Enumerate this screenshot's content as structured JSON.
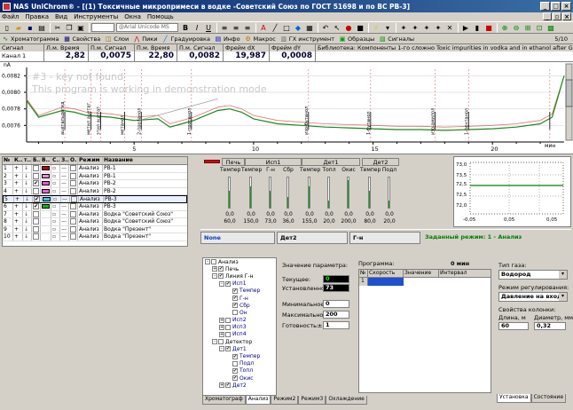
{
  "window": {
    "title": "NAS UniChrom® - [(1) Токсичные микропримеси в водке -Советский Союз по ГОСТ 51698 и по ВС РВ-3]"
  },
  "menu": [
    "Файл",
    "Правка",
    "Вид",
    "Инструменты",
    "Окна",
    "Помощь"
  ],
  "toolbar": {
    "font": "@Arial Unicode MS"
  },
  "tabs": [
    "Хроматограмма",
    "Свойства",
    "Слои",
    "Пики",
    "Градуировка",
    "Инфо",
    "Макрос",
    "ГХ инструмент",
    "Образцы",
    "Сигналы"
  ],
  "page_counter": "5/10",
  "measure": {
    "headers": [
      "Сигнал",
      "Л.м. Время",
      "П.м. Сигнал",
      "П.м. Время",
      "П.м. Сигнал",
      "Фрейм dX",
      "Фрейм dY",
      "Библиотека: Компоненты 1-го сложно Toxic impurities in vodka and in ethanol after GOST 51698 and MC- Template from Vita"
    ],
    "signal": "Канал 1",
    "values": [
      "2,82",
      "0,0075",
      "22,80",
      "0,0082",
      "19,987",
      "0,0008"
    ]
  },
  "chart": {
    "watermark1": "#3 - key not found",
    "watermark2": "This program is working in demonstration mode",
    "unit": "nA",
    "xunit": "мин",
    "yticks": [
      "0,0082",
      "0,0080",
      "0,0078",
      "0,0076"
    ],
    "xticks": [
      "5",
      "10",
      "15",
      "20"
    ],
    "peaks": [
      "ацетальдегид",
      "метил ацетат",
      "этил ацетат",
      "метанол",
      "2-пропанол",
      "1-пропанол",
      "изо-бутанол",
      "1-бутанол",
      "изо-амилол",
      "1-пентанол"
    ]
  },
  "chart_data": {
    "type": "line",
    "xlabel": "мин",
    "ylabel": "nA",
    "xlim": [
      0.5,
      23
    ],
    "ylim": [
      0.0074,
      0.0083
    ],
    "x": [
      0.5,
      1,
      2,
      2.5,
      3,
      3.5,
      4,
      4.5,
      5,
      5.5,
      6,
      6.5,
      7,
      7.5,
      8,
      8.5,
      9,
      9.5,
      10,
      11,
      12,
      13,
      14,
      15,
      16,
      17,
      18,
      19,
      20,
      21,
      22,
      22.5,
      23
    ],
    "series": [
      {
        "values": [
          0.0079,
          0.0077,
          0.00778,
          0.00776,
          0.00772,
          0.00771,
          0.0077,
          0.00768,
          0.00766,
          0.00767,
          0.00768,
          0.00758,
          0.00762,
          0.00766,
          0.00772,
          0.00778,
          0.0078,
          0.00776,
          0.00768,
          0.00762,
          0.0076,
          0.00758,
          0.00757,
          0.00756,
          0.00755,
          0.00755,
          0.00754,
          0.00755,
          0.00756,
          0.00758,
          0.00762,
          0.0077,
          0.0082
        ]
      },
      {
        "values": [
          0.00792,
          0.00772,
          0.00782,
          0.0078,
          0.00776,
          0.00775,
          0.00774,
          0.00772,
          0.0077,
          0.00771,
          0.00772,
          0.00762,
          0.00766,
          0.0077,
          0.00776,
          0.00782,
          0.00784,
          0.0078,
          0.00772,
          0.00766,
          0.00764,
          0.00762,
          0.00761,
          0.0076,
          0.00759,
          0.00759,
          0.00758,
          0.00759,
          0.0076,
          0.00762,
          0.00766,
          0.00774,
          0.0082
        ]
      }
    ]
  },
  "peak_table": {
    "headers": [
      "№",
      "К..",
      "т..",
      "Б..",
      "В..",
      "С..",
      "З..",
      "О..",
      "Режим",
      "Название"
    ],
    "rows": [
      {
        "n": "1",
        "k": "+",
        "b": "",
        "color": "#c00000",
        "mode": "Анализ",
        "name": "РВ-1"
      },
      {
        "n": "2",
        "k": "+",
        "b": "",
        "color": "#ff8ad8",
        "mode": "Анализ",
        "name": "РВ-1"
      },
      {
        "n": "3",
        "k": "+",
        "b": "✔",
        "color": "#ff4fd8",
        "mode": "Анализ",
        "name": "РВ-2"
      },
      {
        "n": "4",
        "k": "+",
        "b": "",
        "color": "#ff5fd0",
        "mode": "Анализ",
        "name": "РВ-2"
      },
      {
        "n": "5",
        "k": "+",
        "b": "✔",
        "color": "#40c0ff",
        "mode": "Анализ",
        "name": "РВ-3"
      },
      {
        "n": "6",
        "k": "+",
        "b": "✔",
        "color": "#00c000",
        "mode": "Анализ",
        "name": "РВ-3"
      },
      {
        "n": "7",
        "k": "+",
        "b": "",
        "color": "",
        "mode": "Анализ",
        "name": "Водка \"Советский Союз\""
      },
      {
        "n": "8",
        "k": "+",
        "b": "",
        "color": "",
        "mode": "Анализ",
        "name": "Водка \"Советский Союз\""
      },
      {
        "n": "9",
        "k": "+",
        "b": "",
        "color": "",
        "mode": "Анализ",
        "name": "Водка \"Презент\""
      },
      {
        "n": "10",
        "k": "+",
        "b": "",
        "color": "",
        "mode": "Анализ",
        "name": "Водка \"Презент\""
      }
    ]
  },
  "devices": {
    "groups": [
      "Печь",
      "Исп1",
      "Дет1",
      "Дет2"
    ],
    "cols": [
      "Темпер",
      "Темпер",
      "Г-н",
      "Сбр",
      "Темпер",
      "Топл",
      "Окис",
      "Темпер",
      "Подл"
    ],
    "values": [
      "0,0",
      "0,0",
      "0,0",
      "0,0",
      "0,0",
      "0,0",
      "0,0",
      "0,0",
      "0,0"
    ],
    "setpoints": [
      "60,0",
      "150,0",
      "73,0",
      "36,0",
      "155,0",
      "20,0",
      "200,0",
      "80,0",
      "20,0"
    ],
    "fills": [
      0.55,
      0.7,
      0.55,
      0.35,
      0.7,
      0.25,
      0.9,
      0.55,
      0.25
    ]
  },
  "miniplot": {
    "yticks": [
      "73,0",
      "72,5",
      "72,0"
    ],
    "yticks2": [
      "73,5",
      "72,5"
    ],
    "xticks": [
      "-0,05",
      "0,05",
      "0,05"
    ]
  },
  "status": {
    "none": "None",
    "det": "Дет2",
    "gn": "Г-н",
    "mode": "Заданный режим: 1 - Анализ"
  },
  "tree": [
    {
      "lvl": 0,
      "ex": "-",
      "cb": "",
      "label": "Анализ"
    },
    {
      "lvl": 1,
      "ex": "+",
      "cb": "✔",
      "label": "Печь"
    },
    {
      "lvl": 1,
      "ex": "-",
      "cb": "✔",
      "label": "Линия Г-н"
    },
    {
      "lvl": 2,
      "ex": "-",
      "cb": "✔",
      "label": "Исп1"
    },
    {
      "lvl": 3,
      "ex": "",
      "cb": "✔",
      "label": "Темпер"
    },
    {
      "lvl": 3,
      "ex": "",
      "cb": "✔",
      "label": "Г-н"
    },
    {
      "lvl": 3,
      "ex": "",
      "cb": "✔",
      "label": "Сбр"
    },
    {
      "lvl": 3,
      "ex": "",
      "cb": "",
      "label": "Он"
    },
    {
      "lvl": 2,
      "ex": "+",
      "cb": "",
      "label": "Исп2"
    },
    {
      "lvl": 2,
      "ex": "+",
      "cb": "",
      "label": "Исп3"
    },
    {
      "lvl": 2,
      "ex": "+",
      "cb": "",
      "label": "Исп4"
    },
    {
      "lvl": 1,
      "ex": "-",
      "cb": "",
      "label": "Детектор"
    },
    {
      "lvl": 2,
      "ex": "-",
      "cb": "✔",
      "label": "Дет1"
    },
    {
      "lvl": 3,
      "ex": "",
      "cb": "✔",
      "label": "Темпер"
    },
    {
      "lvl": 3,
      "ex": "",
      "cb": "",
      "label": "Подл"
    },
    {
      "lvl": 3,
      "ex": "",
      "cb": "✔",
      "label": "Топл"
    },
    {
      "lvl": 3,
      "ex": "",
      "cb": "✔",
      "label": "Окис"
    },
    {
      "lvl": 2,
      "ex": "+",
      "cb": "✔",
      "label": "Дет2"
    }
  ],
  "params": {
    "title": "Значение параметра:",
    "current_label": "Текущее:",
    "current": "0",
    "set_label": "Установленное:",
    "set": "73",
    "min_label": "Минимальное:",
    "min": "0",
    "max_label": "Максимальное:",
    "max": "200",
    "ready_label": "Готовность:",
    "ready_pm": "±",
    "ready": "1"
  },
  "program": {
    "title": "Программа:",
    "time": "0 мин",
    "headers": [
      "№",
      "Скорость",
      "Значение",
      "Интервал"
    ],
    "row": "1"
  },
  "right": {
    "gas_label": "Тип газа:",
    "gas": "Водород",
    "reg_label": "Режим регулирования:",
    "reg": "Давление на входе",
    "col_label": "Свойства колонки:",
    "len_label": "Длина, м",
    "len": "60",
    "dia_label": "Диаметр, мм",
    "dia": "0,32",
    "tabs": [
      "Установка",
      "Состояние"
    ]
  },
  "bottom_tabs": [
    "Хроматограф",
    "Анализ",
    "Режим2",
    "Режим3",
    "Охлаждение"
  ]
}
